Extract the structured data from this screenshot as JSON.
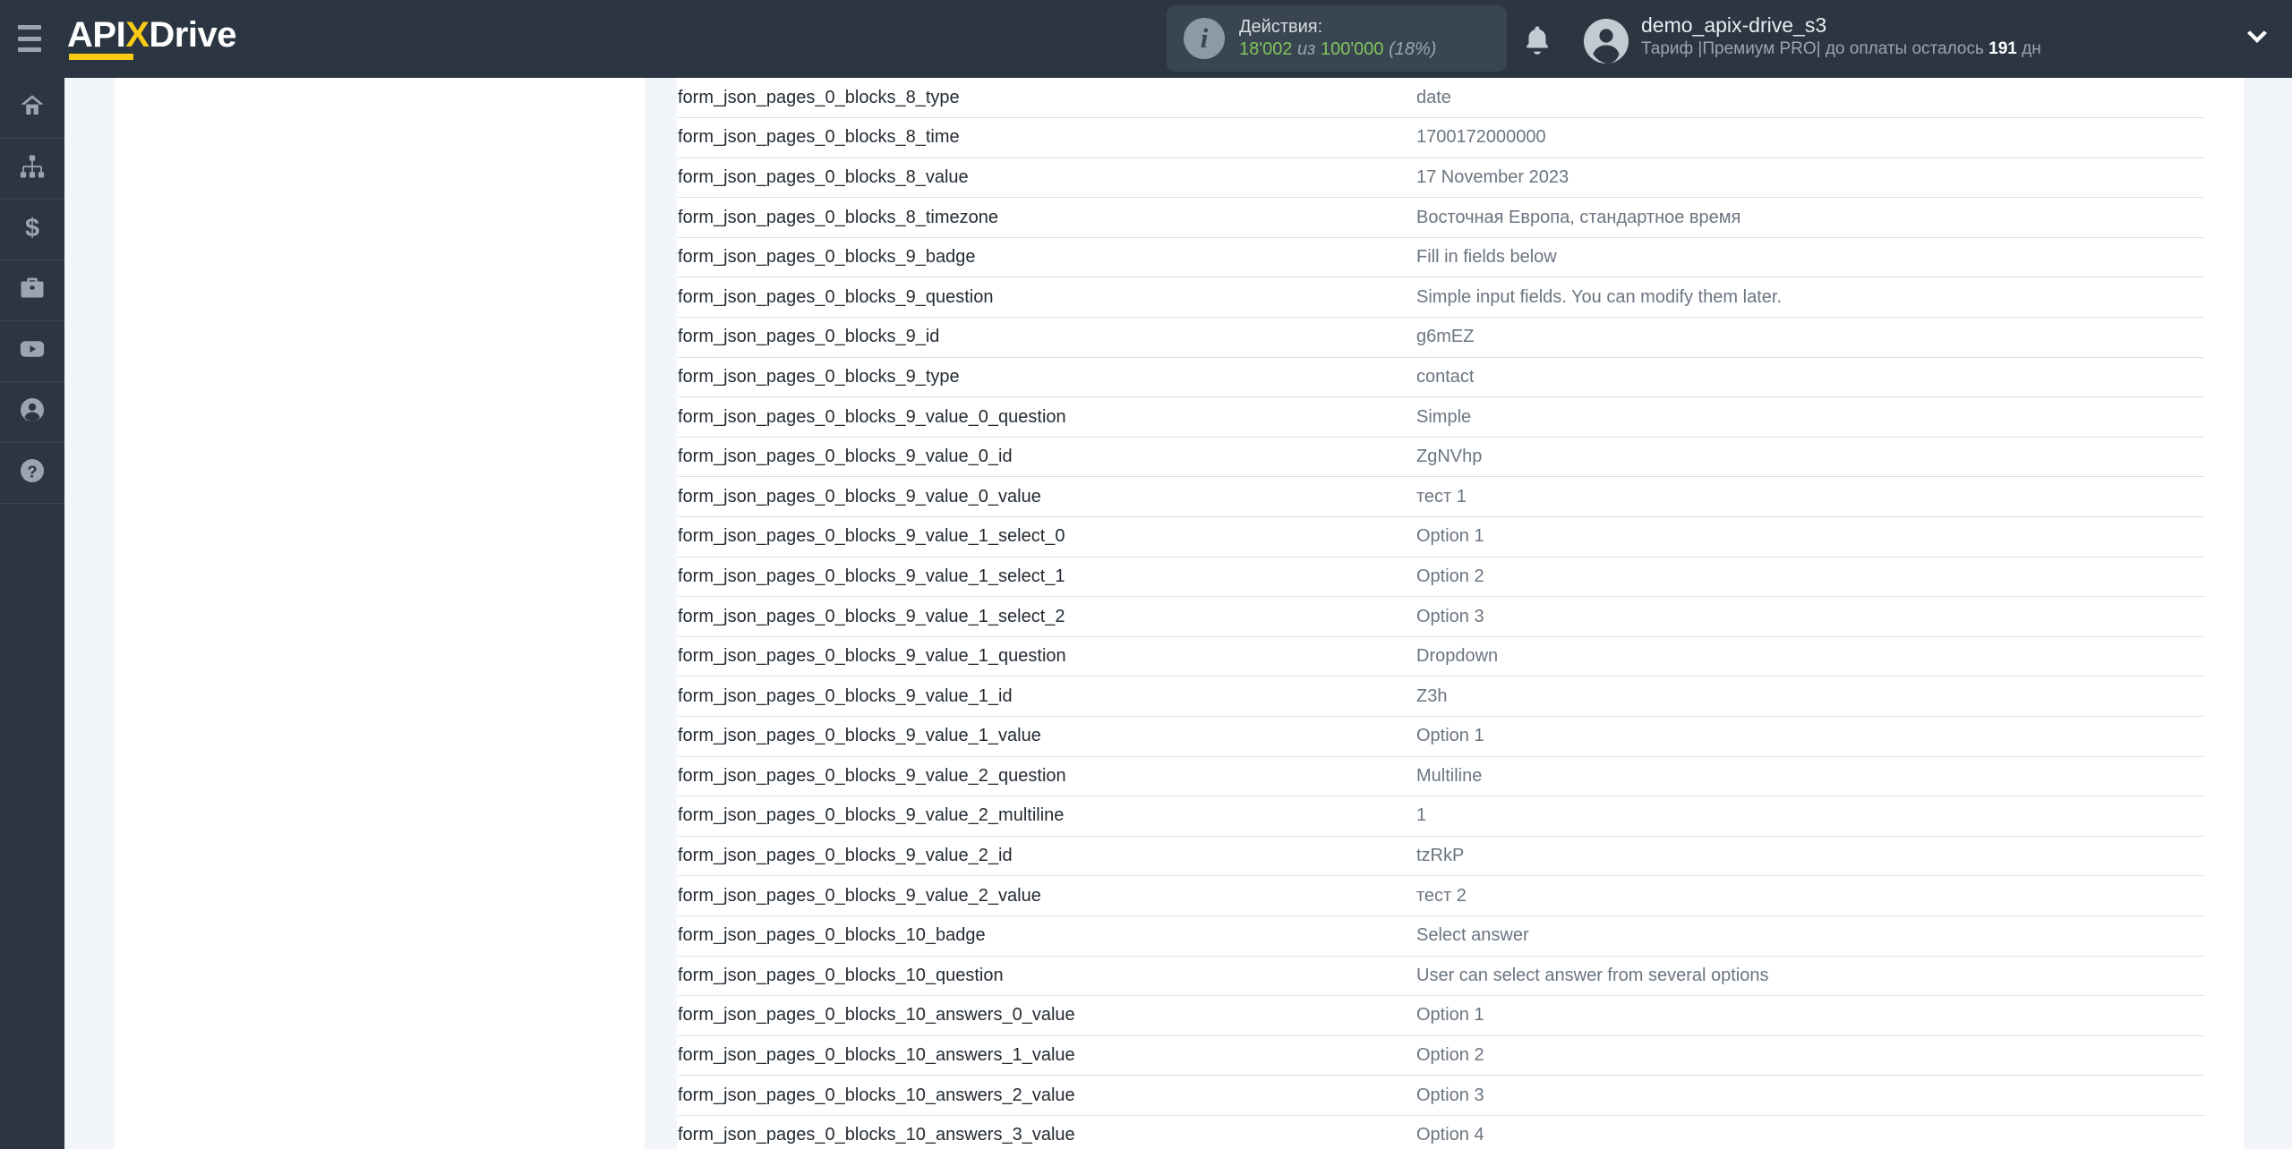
{
  "header": {
    "logo": {
      "text_before": "API",
      "text_x": "X",
      "text_after": "Drive",
      "accent_color": "#f9cb14"
    },
    "menu_icon": "hamburger-icon",
    "actions": {
      "label": "Действия:",
      "used": "18'002",
      "separator": "из",
      "total": "100'000",
      "percent": "(18%)",
      "value_color": "#7fc45a"
    },
    "notifications_icon": "bell-icon",
    "account": {
      "avatar_icon": "user-avatar-icon",
      "name": "demo_apix-drive_s3",
      "plan_prefix": "Тариф |Премиум PRO| до оплаты осталось ",
      "plan_days": "191",
      "plan_suffix": " дн"
    },
    "dropdown_icon": "chevron-down-icon"
  },
  "sidebar": {
    "items": [
      {
        "name": "home",
        "icon": "home-icon"
      },
      {
        "name": "connections",
        "icon": "sitemap-icon"
      },
      {
        "name": "billing",
        "icon": "dollar-icon"
      },
      {
        "name": "business",
        "icon": "briefcase-icon"
      },
      {
        "name": "video",
        "icon": "youtube-icon"
      },
      {
        "name": "account",
        "icon": "user-circle-icon"
      },
      {
        "name": "help",
        "icon": "question-circle-icon"
      }
    ]
  },
  "main": {
    "table": {
      "rows": [
        {
          "key": "form_json_pages_0_blocks_8_type",
          "value": "date"
        },
        {
          "key": "form_json_pages_0_blocks_8_time",
          "value": "1700172000000"
        },
        {
          "key": "form_json_pages_0_blocks_8_value",
          "value": "17 November 2023"
        },
        {
          "key": "form_json_pages_0_blocks_8_timezone",
          "value": "Восточная Европа, стандартное время"
        },
        {
          "key": "form_json_pages_0_blocks_9_badge",
          "value": "Fill in fields below"
        },
        {
          "key": "form_json_pages_0_blocks_9_question",
          "value": "Simple input fields. You can modify them later."
        },
        {
          "key": "form_json_pages_0_blocks_9_id",
          "value": "g6mEZ"
        },
        {
          "key": "form_json_pages_0_blocks_9_type",
          "value": "contact"
        },
        {
          "key": "form_json_pages_0_blocks_9_value_0_question",
          "value": "Simple"
        },
        {
          "key": "form_json_pages_0_blocks_9_value_0_id",
          "value": "ZgNVhp"
        },
        {
          "key": "form_json_pages_0_blocks_9_value_0_value",
          "value": "тест 1"
        },
        {
          "key": "form_json_pages_0_blocks_9_value_1_select_0",
          "value": "Option 1"
        },
        {
          "key": "form_json_pages_0_blocks_9_value_1_select_1",
          "value": "Option 2"
        },
        {
          "key": "form_json_pages_0_blocks_9_value_1_select_2",
          "value": "Option 3"
        },
        {
          "key": "form_json_pages_0_blocks_9_value_1_question",
          "value": "Dropdown"
        },
        {
          "key": "form_json_pages_0_blocks_9_value_1_id",
          "value": "Z3h"
        },
        {
          "key": "form_json_pages_0_blocks_9_value_1_value",
          "value": "Option 1"
        },
        {
          "key": "form_json_pages_0_blocks_9_value_2_question",
          "value": "Multiline"
        },
        {
          "key": "form_json_pages_0_blocks_9_value_2_multiline",
          "value": "1"
        },
        {
          "key": "form_json_pages_0_blocks_9_value_2_id",
          "value": "tzRkP"
        },
        {
          "key": "form_json_pages_0_blocks_9_value_2_value",
          "value": "тест 2"
        },
        {
          "key": "form_json_pages_0_blocks_10_badge",
          "value": "Select answer"
        },
        {
          "key": "form_json_pages_0_blocks_10_question",
          "value": "User can select answer from several options"
        },
        {
          "key": "form_json_pages_0_blocks_10_answers_0_value",
          "value": "Option 1"
        },
        {
          "key": "form_json_pages_0_blocks_10_answers_1_value",
          "value": "Option 2"
        },
        {
          "key": "form_json_pages_0_blocks_10_answers_2_value",
          "value": "Option 3"
        },
        {
          "key": "form_json_pages_0_blocks_10_answers_3_value",
          "value": "Option 4"
        }
      ]
    }
  }
}
